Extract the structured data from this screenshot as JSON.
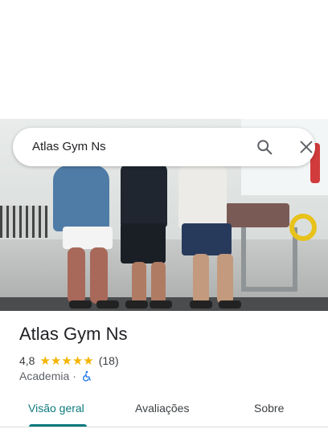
{
  "search": {
    "query": "Atlas Gym Ns"
  },
  "icons": {
    "search": "search-icon",
    "close": "close-icon",
    "accessibility": "wheelchair-icon",
    "star": "star-icon"
  },
  "place": {
    "title": "Atlas Gym Ns",
    "rating": "4,8",
    "stars": 5,
    "review_count": "(18)",
    "category": "Academia",
    "separator": "·"
  },
  "tabs": [
    {
      "label": "Visão geral",
      "active": true
    },
    {
      "label": "Avaliações",
      "active": false
    },
    {
      "label": "Sobre",
      "active": false
    }
  ],
  "colors": {
    "accent": "#0f7a7e",
    "star": "#f4b400",
    "wheelchair": "#1a73e8"
  }
}
